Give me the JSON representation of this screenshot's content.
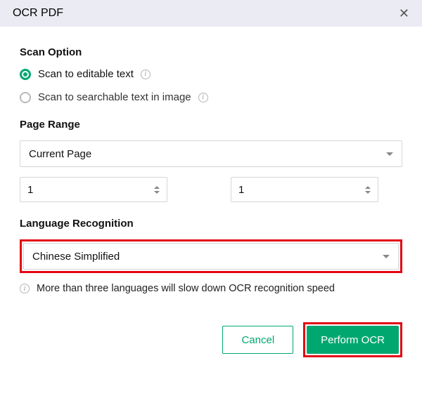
{
  "titlebar": {
    "title": "OCR PDF"
  },
  "scan_option": {
    "label": "Scan Option",
    "opt1": "Scan to editable text",
    "opt2": "Scan to searchable text in image"
  },
  "page_range": {
    "label": "Page Range",
    "selected": "Current Page",
    "from": "1",
    "to": "1"
  },
  "language": {
    "label": "Language Recognition",
    "selected": "Chinese Simplified",
    "warning": "More than three languages will slow down OCR recognition speed"
  },
  "buttons": {
    "cancel": "Cancel",
    "perform": "Perform OCR"
  }
}
